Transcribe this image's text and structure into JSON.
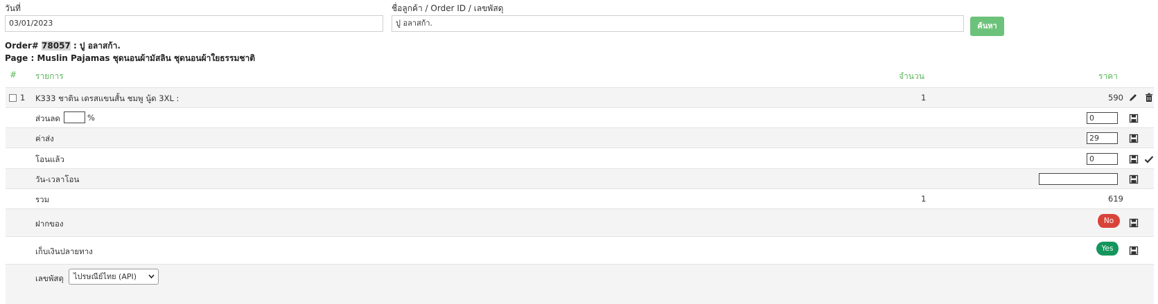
{
  "filters": {
    "date_label": "วันที่",
    "date_value": "03/01/2023",
    "customer_label": "ชื่อลูกค้า / Order ID / เลขพัสดุ",
    "customer_value": "ปู อลาสก้า.",
    "search_button": "ค้นหา"
  },
  "order": {
    "prefix": "Order#",
    "id": "78057",
    "customer_suffix": ": ปู อลาสก้า.",
    "page_line": "Page : Muslin Pajamas ชุดนอนผ้ามัสลิน ชุดนอนผ้าใยธรรมชาติ"
  },
  "table": {
    "col_num": "#",
    "col_item": "รายการ",
    "col_qty": "จำนวน",
    "col_price": "ราคา"
  },
  "items": [
    {
      "num": "1",
      "name": "K333 ชาติน เดรสแขนสั้น ชมพู นู้ด 3XL :",
      "qty": "1",
      "price": "590"
    }
  ],
  "discount": {
    "label": "ส่วนลด",
    "percent_value": "",
    "percent_sign": "%",
    "amount": "0"
  },
  "shipping": {
    "label": "ค่าส่ง",
    "value": "29"
  },
  "transferred": {
    "label": "โอนแล้ว",
    "value": "0"
  },
  "transfer_time": {
    "label": "วัน-เวลาโอน",
    "value": ""
  },
  "total": {
    "label": "รวม",
    "qty": "1",
    "price": "619"
  },
  "deposit": {
    "label": "ฝากของ",
    "toggle": "No",
    "color": "#d9433a"
  },
  "cod": {
    "label": "เก็บเงินปลายทาง",
    "toggle": "Yes",
    "color": "#14965c"
  },
  "tracking": {
    "label": "เลขพัสดุ",
    "carrier": "ไปรษณีย์ไทย (API)"
  },
  "colors": {
    "accent_green": "#5cb85c",
    "button_green": "#6cc27a"
  }
}
